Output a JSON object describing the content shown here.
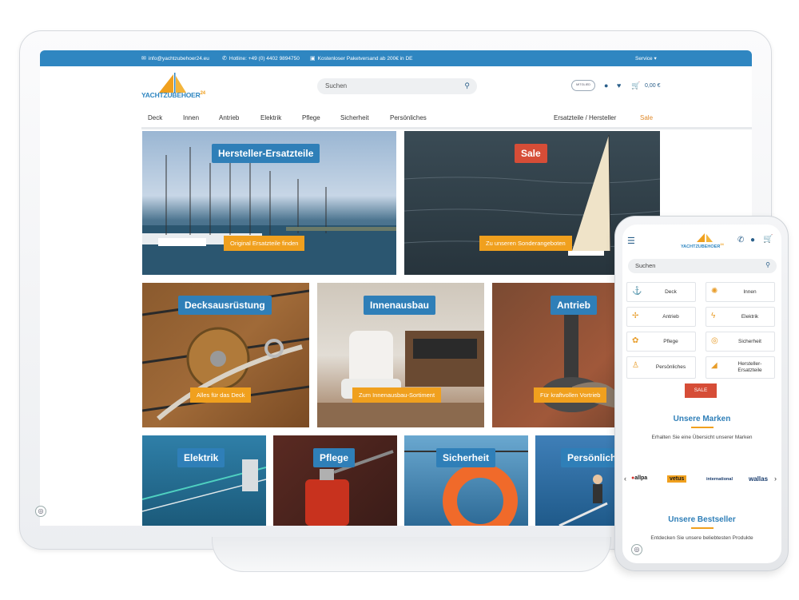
{
  "topbar": {
    "email": "info@yachtzubehoer24.eu",
    "hotline": "Hotline: +49 (0) 4402 9894750",
    "shipping": "Kostenloser Paketversand ab 200€ in DE",
    "service": "Service ▾"
  },
  "header": {
    "logo_text": "YACHTZUBEHOER",
    "logo_sup": "24",
    "search_placeholder": "Suchen",
    "member_badge": "MITGLIED",
    "cart_total": "0,00 €"
  },
  "nav": {
    "items": [
      "Deck",
      "Innen",
      "Antrieb",
      "Elektrik",
      "Pflege",
      "Sicherheit",
      "Persönliches"
    ],
    "right_items": [
      "Ersatzteile / Hersteller",
      "Sale"
    ]
  },
  "tiles": [
    {
      "title": "Hersteller-Ersatzteile",
      "button": "Original Ersatzteile finden"
    },
    {
      "title": "Sale",
      "button": "Zu unseren Sonderangeboten"
    },
    {
      "title": "Decksausrüstung",
      "button": "Alles für das Deck"
    },
    {
      "title": "Innenausbau",
      "button": "Zum Innenausbau-Sortiment"
    },
    {
      "title": "Antrieb",
      "button": "Für kraftvollen Vortrieb"
    },
    {
      "title": "Elektrik"
    },
    {
      "title": "Pflege"
    },
    {
      "title": "Sicherheit"
    },
    {
      "title": "Persönliches"
    }
  ],
  "phone": {
    "logo_text": "YACHTZUBEHOER",
    "logo_sup": "24",
    "search_placeholder": "Suchen",
    "categories": [
      "Deck",
      "Innen",
      "Antrieb",
      "Elektrik",
      "Pflege",
      "Sicherheit",
      "Persönliches",
      "Hersteller-Ersatzteile"
    ],
    "sale": "SALE",
    "brands_heading": "Unsere Marken",
    "brands_sub": "Erhalten Sie eine Übersicht unserer Marken",
    "brands": [
      "allpa",
      "vetus",
      "international",
      "wallas"
    ],
    "bestseller_heading": "Unsere Bestseller",
    "bestseller_sub": "Entdecken Sie unsere beliebtesten Produkte"
  },
  "colors": {
    "brand_blue": "#2f86c1",
    "accent_orange": "#f0a01e",
    "sale_red": "#d64d37"
  },
  "icons": [
    "envelope-icon",
    "phone-icon",
    "box-icon",
    "search-icon",
    "user-icon",
    "heart-icon",
    "cart-icon",
    "menu-icon",
    "fingerprint-icon"
  ]
}
